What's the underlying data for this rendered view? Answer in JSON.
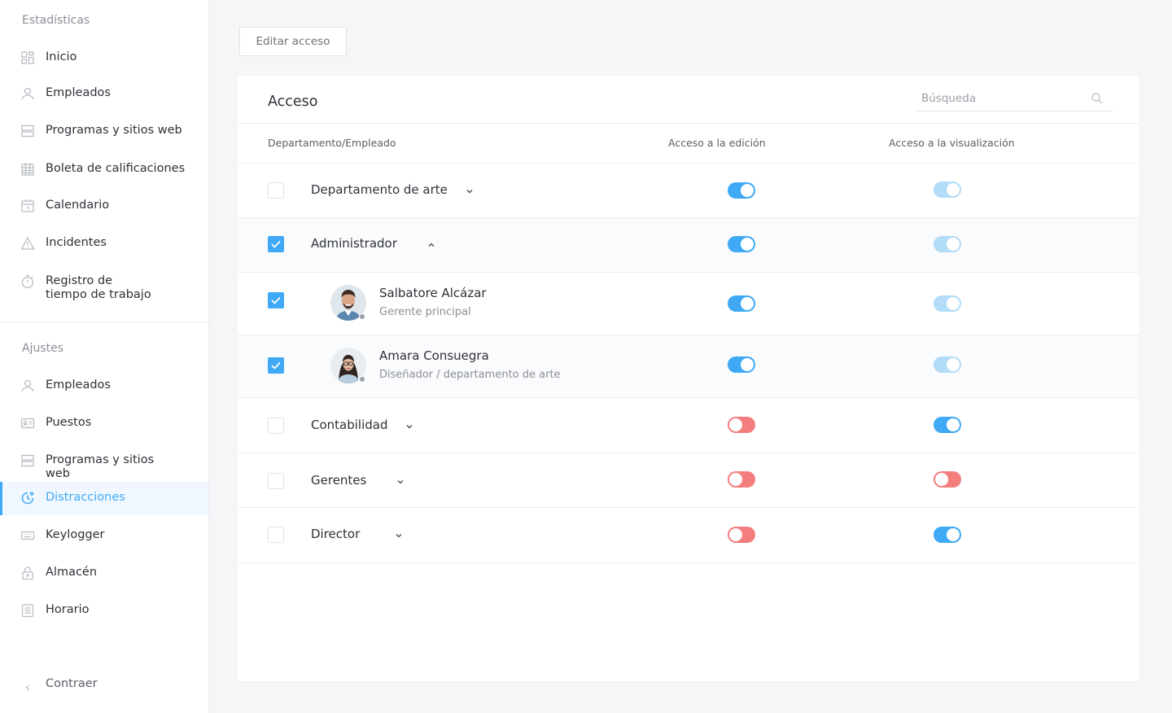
{
  "sidebar": {
    "stats_label": "Estadísticas",
    "stats_items": [
      {
        "label": "Inicio",
        "icon": "dashboard-icon"
      },
      {
        "label": "Empleados",
        "icon": "user-icon"
      },
      {
        "label": "Programas y sitios web",
        "icon": "apps-icon"
      },
      {
        "label": "Boleta de calificaciones",
        "icon": "grid-calendar-icon"
      },
      {
        "label": "Calendario",
        "icon": "calendar-icon"
      },
      {
        "label": "Incidentes",
        "icon": "warning-icon"
      },
      {
        "label": "Registro de\ntiempo de trabajo",
        "icon": "stopwatch-icon"
      }
    ],
    "settings_label": "Ajustes",
    "settings_items": [
      {
        "label": "Empleados",
        "icon": "user-icon"
      },
      {
        "label": "Puestos",
        "icon": "id-card-icon"
      },
      {
        "label": "Programas y sitios\nweb",
        "icon": "apps-icon"
      },
      {
        "label": "Distracciones",
        "icon": "distraction-clock-icon",
        "active": true
      },
      {
        "label": "Keylogger",
        "icon": "keyboard-icon"
      },
      {
        "label": "Almacén",
        "icon": "lock-icon"
      },
      {
        "label": "Horario",
        "icon": "schedule-icon"
      }
    ],
    "collapse_label": "Contraer"
  },
  "toolbar": {
    "edit_label": "Editar acceso"
  },
  "card": {
    "title": "Acceso",
    "search_placeholder": "Búsqueda",
    "columns": {
      "entity": "Departamento/Empleado",
      "edit": "Acceso a la edición",
      "view": "Acceso a la visualización"
    },
    "rows": [
      {
        "type": "dept",
        "label": "Departamento de arte",
        "checked": false,
        "expanded": false,
        "edit": "on-blue",
        "view": "on-light"
      },
      {
        "type": "dept",
        "label": "Administrador",
        "checked": true,
        "expanded": true,
        "edit": "on-blue",
        "view": "on-light"
      },
      {
        "type": "employee",
        "name": "Salbatore Alcázar",
        "role": "Gerente principal",
        "checked": true,
        "edit": "on-blue",
        "view": "on-light"
      },
      {
        "type": "employee",
        "name": "Amara Consuegra",
        "role": "Diseñador / departamento de arte",
        "checked": true,
        "edit": "on-blue",
        "view": "on-light"
      },
      {
        "type": "dept",
        "label": "Contabilidad",
        "checked": false,
        "expanded": false,
        "edit": "off-red",
        "view": "on-blue"
      },
      {
        "type": "dept",
        "label": "Gerentes",
        "checked": false,
        "expanded": false,
        "edit": "off-red",
        "view": "off-red"
      },
      {
        "type": "dept",
        "label": "Director",
        "checked": false,
        "expanded": false,
        "edit": "off-red",
        "view": "on-blue"
      }
    ]
  },
  "colors": {
    "accent": "#3fa9f5",
    "accent_light": "#b3dcf9",
    "danger": "#f47e7e"
  }
}
